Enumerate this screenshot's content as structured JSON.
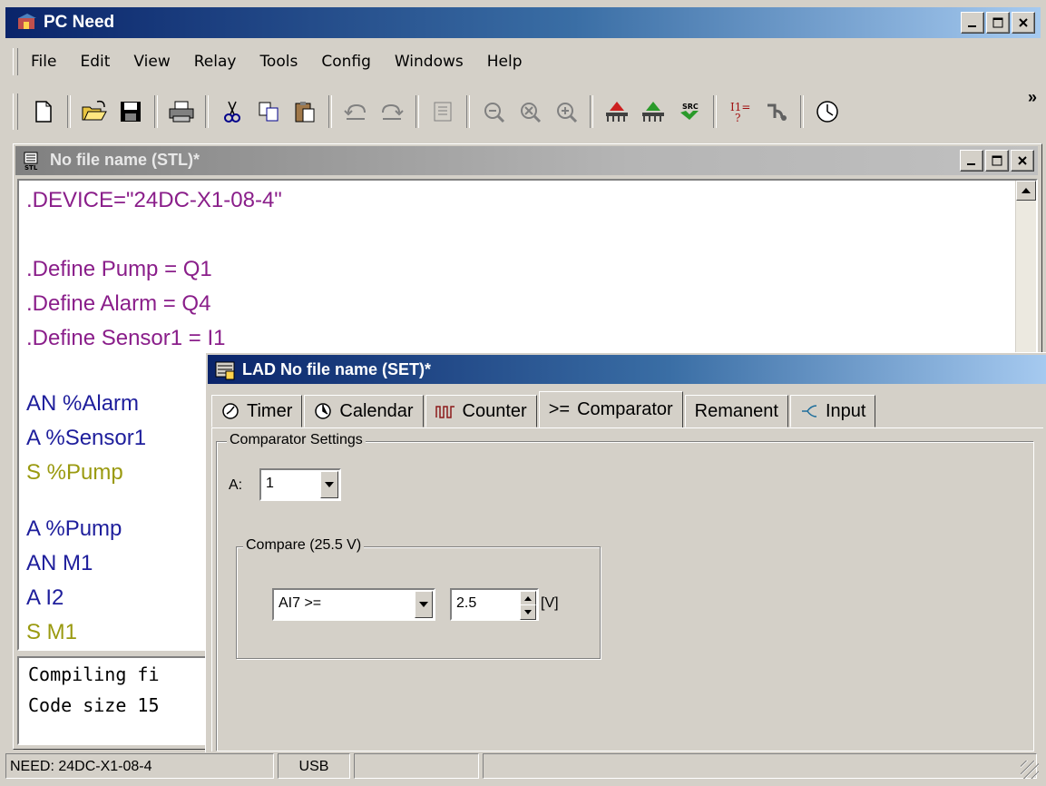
{
  "app": {
    "title": "PC Need",
    "menu": [
      "File",
      "Edit",
      "View",
      "Relay",
      "Tools",
      "Config",
      "Windows",
      "Help"
    ],
    "toolbar_more": "»"
  },
  "toolbar_icons": [
    "new-file-icon",
    "open-folder-icon",
    "save-icon",
    "print-icon",
    "cut-icon",
    "copy-icon",
    "paste-icon",
    "undo-icon",
    "redo-icon",
    "convert-icon",
    "zoom-out-icon",
    "zoom-fit-icon",
    "zoom-in-icon",
    "download-icon",
    "upload-icon",
    "source-icon",
    "compare-icon",
    "debug-icon",
    "clock-icon"
  ],
  "stl_window": {
    "title": "No file name (STL)*",
    "code": [
      {
        "text": ".DEVICE=\"24DC-X1-08-4\"",
        "color": "purple"
      },
      {
        "text": ".Define Pump = Q1",
        "color": "purple"
      },
      {
        "text": ".Define Alarm = Q4",
        "color": "purple"
      },
      {
        "text": ".Define Sensor1 = I1",
        "color": "purple"
      },
      {
        "text": "AN %Alarm",
        "color": "blue"
      },
      {
        "text": "A %Sensor1",
        "color": "blue"
      },
      {
        "text": "S %Pump",
        "color": "olive"
      },
      {
        "text": "A %Pump",
        "color": "blue"
      },
      {
        "text": "AN M1",
        "color": "blue"
      },
      {
        "text": "A I2",
        "color": "blue"
      },
      {
        "text": "S M1",
        "color": "olive"
      }
    ],
    "output": [
      "Compiling fi",
      "Code size 15"
    ]
  },
  "lad_window": {
    "title": "LAD No file name (SET)*",
    "tabs": [
      {
        "label": "Timer",
        "icon": "timer-icon"
      },
      {
        "label": "Calendar",
        "icon": "calendar-icon"
      },
      {
        "label": "Counter",
        "icon": "counter-icon"
      },
      {
        "label": "Comparator",
        "icon": ">="
      },
      {
        "label": "Remanent",
        "icon": ""
      },
      {
        "label": "Input",
        "icon": "input-icon"
      }
    ],
    "active_tab": "Comparator",
    "settings": {
      "group_label": "Comparator Settings",
      "a_label": "A:",
      "a_value": "1",
      "compare_label": "Compare  (25.5 V)",
      "compare_select": "AI7 >=",
      "compare_value": "2.5",
      "unit": "[V]"
    }
  },
  "statusbar": {
    "device": "NEED: 24DC-X1-08-4",
    "connection": "USB",
    "extra": ""
  }
}
